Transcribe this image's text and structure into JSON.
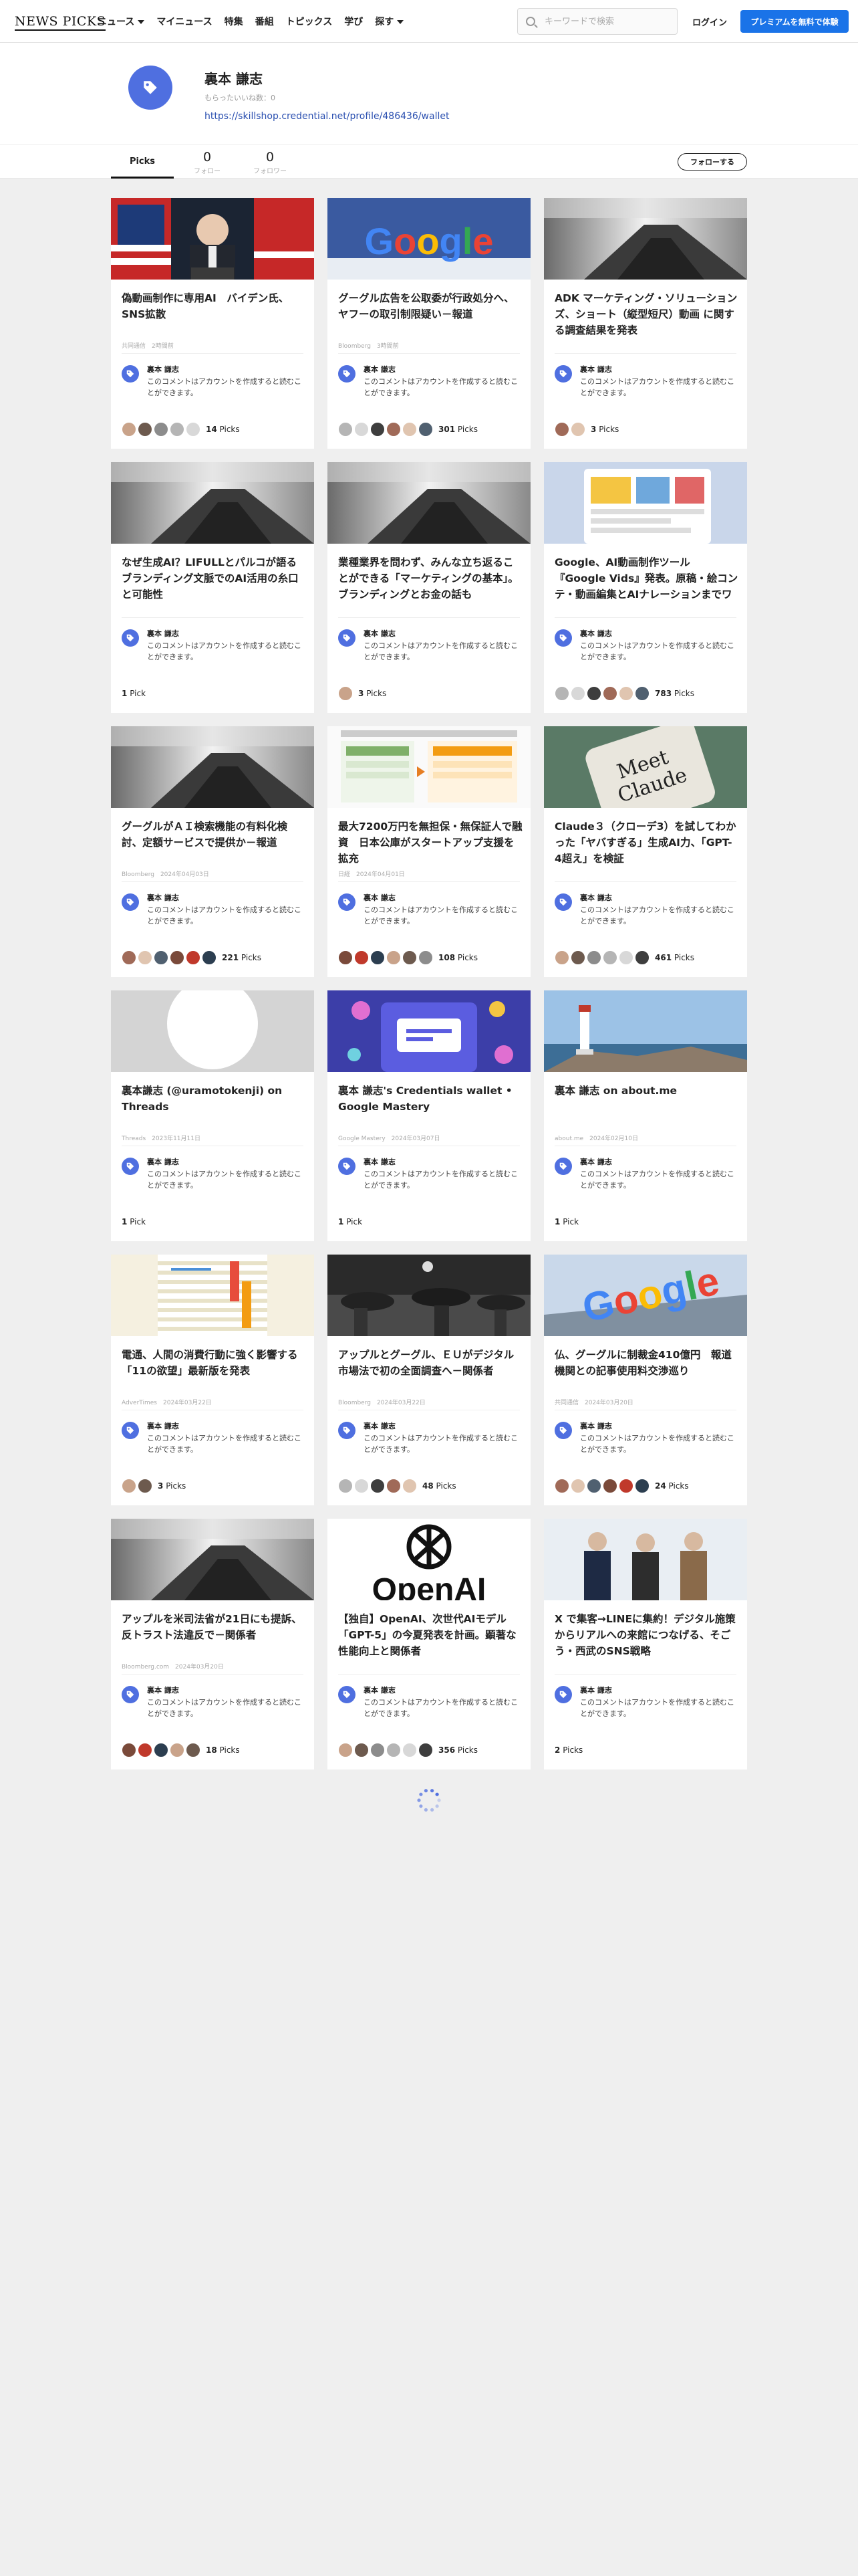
{
  "header": {
    "logo": "NEWS PICKS",
    "nav": [
      {
        "label": "ニュース",
        "dropdown": true
      },
      {
        "label": "マイニュース",
        "dropdown": false
      },
      {
        "label": "特集",
        "dropdown": false
      },
      {
        "label": "番組",
        "dropdown": false
      },
      {
        "label": "トピックス",
        "dropdown": false
      },
      {
        "label": "学び",
        "dropdown": false
      },
      {
        "label": "探す",
        "dropdown": true
      }
    ],
    "search_placeholder": "キーワードで検索",
    "login_label": "ログイン",
    "premium_label": "プレミアムを無料で体験",
    "accent_color": "#1a73e8"
  },
  "profile": {
    "name": "裏本 謙志",
    "likes": "もらったいいね数：0",
    "link": "https://skillshop.credential.net/profile/486436/wallet",
    "avatar_icon": "tag-icon"
  },
  "stats": {
    "picks_tab": "Picks",
    "follow_count": "0",
    "follow_label": "フォロー",
    "follower_count": "0",
    "follower_label": "フォロワー",
    "follow_button": "フォローする"
  },
  "comment": {
    "user": "裏本 謙志",
    "text": "このコメントはアカウントを作成すると読むことができます。"
  },
  "cards": [
    {
      "title": "偽動画制作に専用AI　バイデン氏、SNS拡散",
      "meta": "共同通信　2時間前",
      "picks": "14",
      "thumb": "podium",
      "avatars": 5
    },
    {
      "title": "グーグル広告を公取委が行政処分へ、ヤフーの取引制限疑い－報道",
      "meta": "Bloomberg　3時間前",
      "picks": "301",
      "thumb": "google-sign",
      "avatars": 6
    },
    {
      "title": "ADK マーケティング・ソリューションズ、ショート（縦型短尺）動画 に関する調査結果を発表",
      "meta": "",
      "picks": "3",
      "thumb": "conference-room",
      "avatars": 2
    },
    {
      "title": "なぜ生成AI？LIFULLとパルコが語るブランディング文脈でのAI活用の糸口と可能性",
      "meta": "",
      "picks": "1",
      "thumb": "conference-room",
      "avatars": 0
    },
    {
      "title": "業種業界を問わず、みんな立ち返ることができる「マーケティングの基本」。ブランディングとお金の話も",
      "meta": "",
      "picks": "3",
      "thumb": "conference-room",
      "avatars": 1
    },
    {
      "title": "Google、AI動画制作ツール『Google Vids』発表。原稿・絵コンテ・動画編集とAIナレーションまでワンストップの新しいWo...",
      "meta": "",
      "picks": "783",
      "thumb": "screen-ui",
      "avatars": 6
    },
    {
      "title": "グーグルがＡＩ検索機能の有料化検討、定額サービスで提供か－報道",
      "meta": "Bloomberg　2024年04月03日",
      "picks": "221",
      "thumb": "conference-room",
      "avatars": 6
    },
    {
      "title": "最大7200万円を無担保・無保証人で融資　日本公庫がスタートアップ支援を拡充",
      "meta": "日経　2024年04月01日",
      "picks": "108",
      "thumb": "document-chart",
      "avatars": 6
    },
    {
      "title": "Claude３（クローデ3）を試してわかった「ヤバすぎる」生成AI力、「GPT-4超え」を検証",
      "meta": "",
      "picks": "461",
      "thumb": "meet-claude",
      "avatars": 6
    },
    {
      "title": "裏本謙志 (@uramotokenji) on Threads",
      "meta": "Threads　2023年11月11日",
      "picks": "1",
      "thumb": "threads-circle",
      "avatars": 0
    },
    {
      "title": "裏本 謙志's Credentials wallet • Google Mastery",
      "meta": "Google Mastery　2024年03月07日",
      "picks": "1",
      "thumb": "credentials",
      "avatars": 0
    },
    {
      "title": "裏本 謙志 on about.me",
      "meta": "about.me　2024年02月10日",
      "picks": "1",
      "thumb": "lighthouse",
      "avatars": 0
    },
    {
      "title": "電通、人間の消費行動に強く影響する「11の欲望」最新版を発表",
      "meta": "AdverTimes　2024年03月22日",
      "picks": "3",
      "thumb": "spreadsheet",
      "avatars": 2
    },
    {
      "title": "アップルとグーグル、ＥＵがデジタル市場法で初の全面調査へ－関係者",
      "meta": "Bloomberg　2024年03月22日",
      "picks": "48",
      "thumb": "apple-street",
      "avatars": 5
    },
    {
      "title": "仏、グーグルに制裁金410億円　報道機関との記事使用料交渉巡り",
      "meta": "共同通信　2024年03月20日",
      "picks": "24",
      "thumb": "google-building",
      "avatars": 6
    },
    {
      "title": "アップルを米司法省が21日にも提訴、反トラスト法違反で－関係者",
      "meta": "Bloomberg.com　2024年03月20日",
      "picks": "18",
      "thumb": "conference-room",
      "avatars": 5
    },
    {
      "title": "【独自】OpenAI、次世代AIモデル「GPT-5」の今夏発表を計画。顕著な性能向上と関係者",
      "meta": "",
      "picks": "356",
      "thumb": "openai",
      "avatars": 6
    },
    {
      "title": "X で集客→LINEに集約！デジタル施策からリアルへの来館につなげる、そごう・西武のSNS戦略",
      "meta": "",
      "picks": "2",
      "thumb": "three-people",
      "avatars": 0
    }
  ],
  "avatar_palette": [
    "#c9a38a",
    "#6d5a4e",
    "#8c8c8c",
    "#b5b5b5",
    "#d8d8d8",
    "#3e3e3e",
    "#a06a58",
    "#e0c5b0",
    "#506070",
    "#7a4a3a",
    "#c0392b",
    "#2c3e50"
  ],
  "pick_suffix": "Picks",
  "pick_suffix_single": "Pick"
}
